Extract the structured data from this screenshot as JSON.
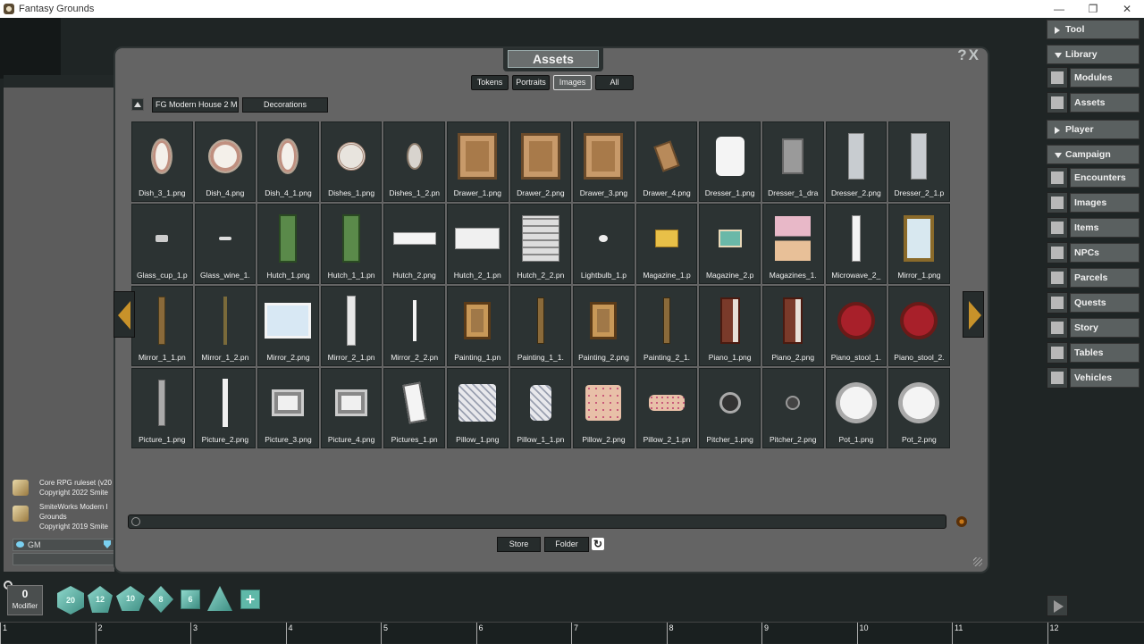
{
  "window": {
    "title": "Fantasy Grounds"
  },
  "chat": {
    "entries": [
      {
        "line1": "Core RPG ruleset (v20",
        "line2": "Copyright 2022 Smite"
      },
      {
        "line1": "SmiteWorks Modern I",
        "line2": "Grounds",
        "line3": "Copyright 2019 Smite"
      }
    ],
    "identity": "GM"
  },
  "assets": {
    "title": "Assets",
    "help_close": "?X",
    "tabs": [
      {
        "label": "Tokens",
        "active": false
      },
      {
        "label": "Portraits",
        "active": false
      },
      {
        "label": "Images",
        "active": true
      },
      {
        "label": "All",
        "active": false
      }
    ],
    "breadcrumb": [
      "FG Modern House 2 Ma",
      "Decorations"
    ],
    "items": [
      {
        "name": "Dish_3_1.png",
        "kind": "dish-oval"
      },
      {
        "name": "Dish_4.png",
        "kind": "dish-round"
      },
      {
        "name": "Dish_4_1.png",
        "kind": "dish-oval"
      },
      {
        "name": "Dishes_1.png",
        "kind": "dishes"
      },
      {
        "name": "Dishes_1_2.pn",
        "kind": "dish-small"
      },
      {
        "name": "Drawer_1.png",
        "kind": "drawer"
      },
      {
        "name": "Drawer_2.png",
        "kind": "drawer"
      },
      {
        "name": "Drawer_3.png",
        "kind": "drawer"
      },
      {
        "name": "Drawer_4.png",
        "kind": "drawer-small"
      },
      {
        "name": "Dresser_1.png",
        "kind": "dresser-white"
      },
      {
        "name": "Dresser_1_dra",
        "kind": "dresser-grey"
      },
      {
        "name": "Dresser_2.png",
        "kind": "dresser-tall"
      },
      {
        "name": "Dresser_2_1.p",
        "kind": "dresser-tall"
      },
      {
        "name": "Glass_cup_1.p",
        "kind": "cup"
      },
      {
        "name": "Glass_wine_1.",
        "kind": "wine"
      },
      {
        "name": "Hutch_1.png",
        "kind": "hutch-green"
      },
      {
        "name": "Hutch_1_1.pn",
        "kind": "hutch-green"
      },
      {
        "name": "Hutch_2.png",
        "kind": "hutch-white"
      },
      {
        "name": "Hutch_2_1.pn",
        "kind": "hutch-white2"
      },
      {
        "name": "Hutch_2_2.pn",
        "kind": "hutch-shelf"
      },
      {
        "name": "Lightbulb_1.p",
        "kind": "bulb"
      },
      {
        "name": "Magazine_1.p",
        "kind": "magazine"
      },
      {
        "name": "Magazine_2.p",
        "kind": "magazine2"
      },
      {
        "name": "Magazines_1.",
        "kind": "magazines"
      },
      {
        "name": "Microwave_2_",
        "kind": "microwave"
      },
      {
        "name": "Mirror_1.png",
        "kind": "mirror-gold"
      },
      {
        "name": "Mirror_1_1.pn",
        "kind": "mirror-side"
      },
      {
        "name": "Mirror_1_2.pn",
        "kind": "mirror-thin"
      },
      {
        "name": "Mirror_2.png",
        "kind": "mirror-wide"
      },
      {
        "name": "Mirror_2_1.pn",
        "kind": "mirror-white"
      },
      {
        "name": "Mirror_2_2.pn",
        "kind": "mirror-line"
      },
      {
        "name": "Painting_1.pn",
        "kind": "painting"
      },
      {
        "name": "Painting_1_1.",
        "kind": "painting-side"
      },
      {
        "name": "Painting_2.png",
        "kind": "painting"
      },
      {
        "name": "Painting_2_1.",
        "kind": "painting-side"
      },
      {
        "name": "Piano_1.png",
        "kind": "piano"
      },
      {
        "name": "Piano_2.png",
        "kind": "piano"
      },
      {
        "name": "Piano_stool_1.",
        "kind": "stool"
      },
      {
        "name": "Piano_stool_2.",
        "kind": "stool"
      },
      {
        "name": "Picture_1.png",
        "kind": "picture-side"
      },
      {
        "name": "Picture_2.png",
        "kind": "picture-white"
      },
      {
        "name": "Picture_3.png",
        "kind": "picture-frame"
      },
      {
        "name": "Picture_4.png",
        "kind": "picture-frame"
      },
      {
        "name": "Pictures_1.pn",
        "kind": "pictures"
      },
      {
        "name": "Pillow_1.png",
        "kind": "pillow"
      },
      {
        "name": "Pillow_1_1.pn",
        "kind": "pillow-small"
      },
      {
        "name": "Pillow_2.png",
        "kind": "pillow-floral"
      },
      {
        "name": "Pillow_2_1.pn",
        "kind": "pillow-flat"
      },
      {
        "name": "Pitcher_1.png",
        "kind": "pitcher"
      },
      {
        "name": "Pitcher_2.png",
        "kind": "pitcher-small"
      },
      {
        "name": "Pot_1.png",
        "kind": "pot"
      },
      {
        "name": "Pot_2.png",
        "kind": "pot"
      }
    ],
    "buttons": {
      "store": "Store",
      "folder": "Folder"
    }
  },
  "sidebar": {
    "sections": [
      {
        "label": "Tool",
        "expanded": false,
        "items": []
      },
      {
        "label": "Library",
        "expanded": true,
        "items": [
          {
            "label": "Modules",
            "icon": "modules-icon"
          },
          {
            "label": "Assets",
            "icon": "puzzle-icon"
          }
        ]
      },
      {
        "label": "Player",
        "expanded": false,
        "items": []
      },
      {
        "label": "Campaign",
        "expanded": true,
        "items": [
          {
            "label": "Encounters",
            "icon": "crossed-swords-icon"
          },
          {
            "label": "Images",
            "icon": "map-icon"
          },
          {
            "label": "Items",
            "icon": "bag-icon"
          },
          {
            "label": "NPCs",
            "icon": "skull-icon"
          },
          {
            "label": "Parcels",
            "icon": "chest-icon"
          },
          {
            "label": "Quests",
            "icon": "chalice-icon"
          },
          {
            "label": "Story",
            "icon": "book-icon"
          },
          {
            "label": "Tables",
            "icon": "dice-icon"
          },
          {
            "label": "Vehicles",
            "icon": "ship-icon"
          }
        ]
      }
    ]
  },
  "modifier": {
    "value": "0",
    "label": "Modifier"
  },
  "dice": [
    {
      "label": "20",
      "name": "d20-die"
    },
    {
      "label": "12",
      "name": "d12-die"
    },
    {
      "label": "10",
      "name": "d10-die"
    },
    {
      "label": "8",
      "name": "d8-die"
    },
    {
      "label": "6",
      "name": "d6-die"
    },
    {
      "label": "",
      "name": "d4-die"
    }
  ],
  "dice_add": "+",
  "hotbar": [
    "1",
    "2",
    "3",
    "4",
    "5",
    "6",
    "7",
    "8",
    "9",
    "10",
    "11",
    "12"
  ],
  "colors": {
    "panel": "#646464",
    "cell": "#2c3333",
    "sidebar": "#5a6060",
    "dice": "#5fb8a8"
  }
}
